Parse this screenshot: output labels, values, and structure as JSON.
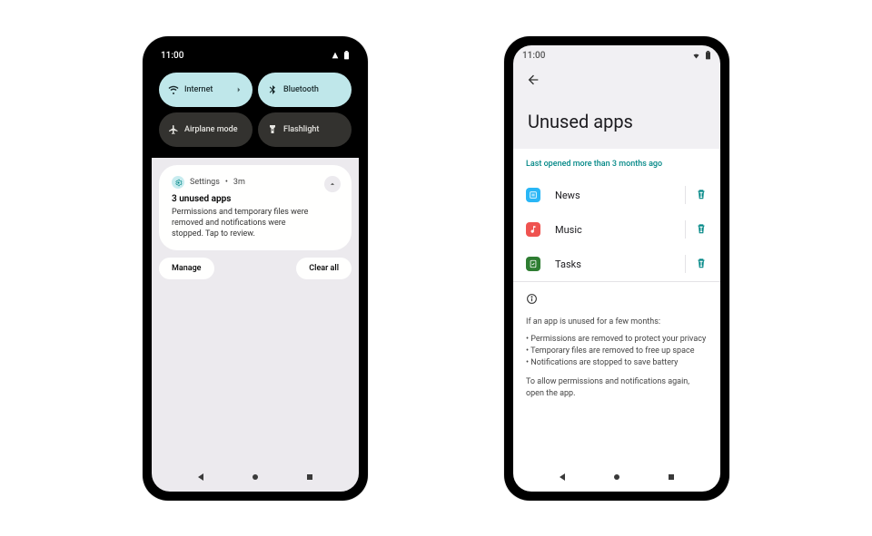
{
  "left": {
    "time": "11:00",
    "quick_settings": [
      {
        "label": "Internet",
        "icon": "wifi",
        "state": "active",
        "has_chevron": true
      },
      {
        "label": "Bluetooth",
        "icon": "bluetooth",
        "state": "active",
        "has_chevron": false
      },
      {
        "label": "Airplane mode",
        "icon": "airplane",
        "state": "inactive",
        "has_chevron": false
      },
      {
        "label": "Flashlight",
        "icon": "flashlight",
        "state": "inactive",
        "has_chevron": false
      }
    ],
    "notification": {
      "app_name": "Settings",
      "time_since": "3m",
      "title": "3 unused apps",
      "body": "Permissions and temporary files were removed and notifications were stopped. Tap to review."
    },
    "actions": {
      "manage": "Manage",
      "clear_all": "Clear all"
    }
  },
  "right": {
    "time": "11:00",
    "title": "Unused apps",
    "section_header": "Last opened more than 3 months ago",
    "apps": [
      {
        "name": "News",
        "color": "#29b6f6"
      },
      {
        "name": "Music",
        "color": "#ef5350"
      },
      {
        "name": "Tasks",
        "color": "#2e7d32"
      }
    ],
    "info": {
      "heading": "If an app is unused for a few months:",
      "bullets": [
        "Permissions are removed to protect your privacy",
        "Temporary files are removed to free up space",
        "Notifications are stopped to save battery"
      ],
      "footer": "To allow permissions and notifications again, open the app."
    }
  }
}
